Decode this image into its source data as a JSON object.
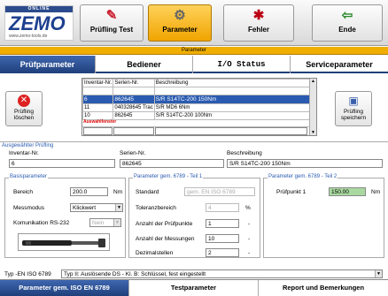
{
  "toolbar": {
    "logo_online": "ONLINE",
    "logo_brand": "ZEMO",
    "logo_url": "www.zemo-tools.de",
    "buttons": [
      {
        "label": "Prüfling Test",
        "icon": "pencil-icon"
      },
      {
        "label": "Parameter",
        "icon": "gear-icon"
      },
      {
        "label": "Fehler",
        "icon": "bug-icon"
      },
      {
        "label": "Ende",
        "icon": "exit-icon"
      }
    ]
  },
  "band_title": "Parameter",
  "main_tabs": [
    "Prüfparameter",
    "Bediener",
    "I/O Status",
    "Serviceparameter"
  ],
  "buttons": {
    "delete": "Prüfling löschen",
    "save": "Prüfling speichern"
  },
  "grid": {
    "columns": [
      "Inventar-Nr.",
      "Serien-Nr.",
      "Beschreibung"
    ],
    "rows": [
      [
        "",
        "",
        ""
      ],
      [
        "6",
        "862645",
        "S/R S14TC-200 150Nm"
      ],
      [
        "11",
        "040328645 Trac",
        "S/R MD6 6Nm"
      ],
      [
        "10",
        "862645",
        "S/R S14TC-200 100Nm"
      ]
    ],
    "filter_label": "Auswahlfenster"
  },
  "selected": {
    "title": "Ausgewählter Prüfling",
    "inv_label": "Inventar-Nr.",
    "inv_value": "6",
    "ser_label": "Serien-Nr.",
    "ser_value": "862645",
    "desc_label": "Beschreibung",
    "desc_value": "S/R S14TC-200 150Nm"
  },
  "basis": {
    "title": "Basisparameter",
    "range_label": "Bereich",
    "range_value": "200.0",
    "range_unit": "Nm",
    "mode_label": "Messmodus",
    "mode_value": "Klickwert",
    "comm_label": "Komunikation RS-232",
    "comm_value": "Nein"
  },
  "param1": {
    "title": "Parameter gem. 6789 - Teil 1",
    "standard_label": "Standard",
    "standard_value": "gem. EN ISO 6789",
    "tol_label": "Toleranzbereich",
    "tol_value": "4",
    "tol_unit": "%",
    "points_label": "Anzahl der Prüfpunkte",
    "points_value": "1",
    "meas_label": "Anzahl der Messungen",
    "meas_value": "10",
    "dec_label": "Dezimalstellen",
    "dec_value": "2",
    "dash": "-"
  },
  "param2": {
    "title": "Parameter gem. 6789 - Teil 2",
    "p1_label": "Prüfpunkt 1",
    "p1_value": "150.00",
    "p1_unit": "Nm"
  },
  "type_row": {
    "label": "Typ -EN ISO 6789",
    "value": "Typ II: Auslösende DS - Kl. B: Schlüssel, fest eingestellt"
  },
  "bottom_tabs": [
    "Parameter gem. ISO EN 6789",
    "Testparameter",
    "Report und Bemerkungen"
  ]
}
